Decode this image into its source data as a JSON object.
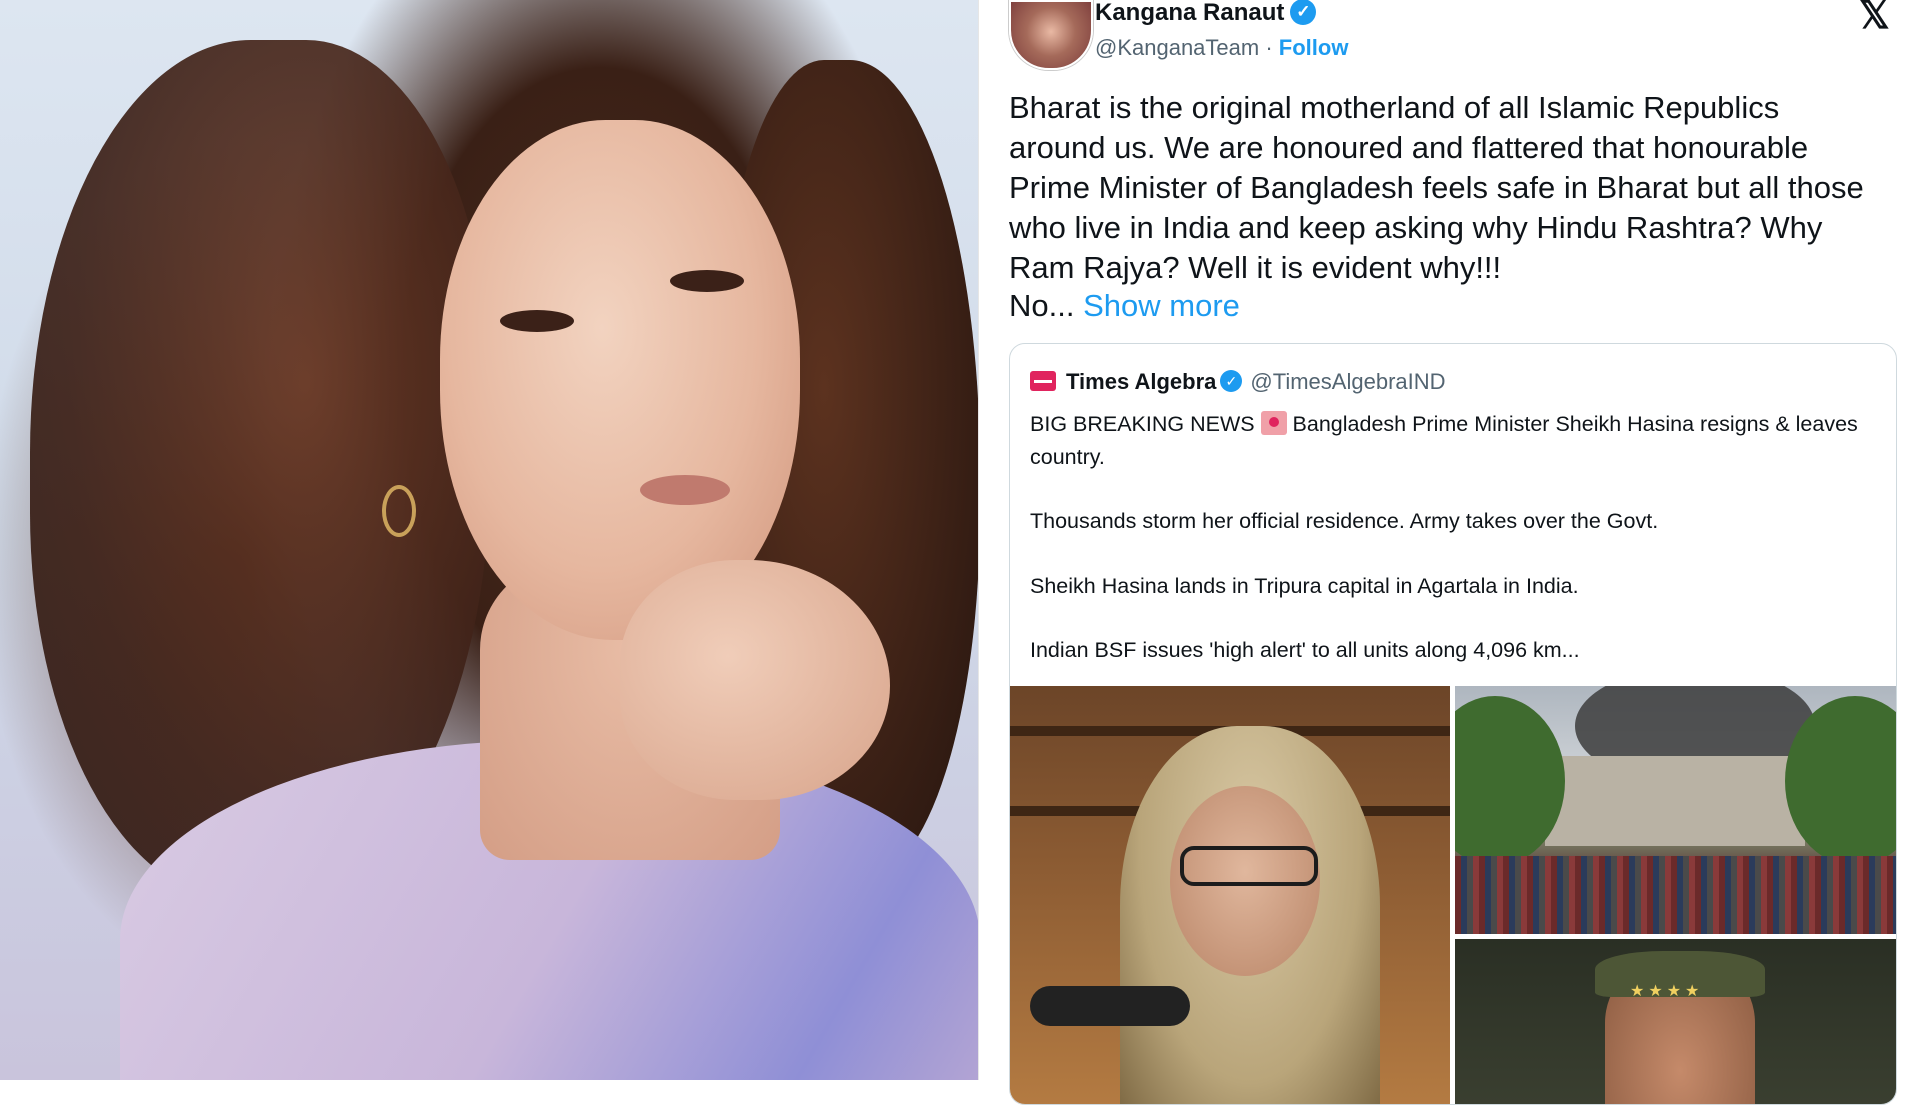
{
  "portrait": {
    "description_icon": "portrait-photo"
  },
  "tweet": {
    "author": {
      "name": "Kangana Ranaut",
      "verified_glyph": "✓",
      "handle": "@KanganaTeam",
      "separator": " · ",
      "follow_label": "Follow"
    },
    "close_glyph": "𝕏",
    "text": "Bharat is the original motherland of all Islamic Republics\naround us. We are honoured and flattered that honourable\nPrime Minister of Bangladesh feels safe in Bharat but all those\nwho live in India and keep asking why Hindu Rashtra? Why\nRam Rajya? Well it is evident why!!!",
    "truncated_prefix": "No... ",
    "show_more_label": "Show more",
    "quote": {
      "name": "Times Algebra",
      "verified_glyph": "✓",
      "handle": "@TimesAlgebraIND",
      "line1_prefix": "BIG BREAKING NEWS ",
      "line1_suffix": " Bangladesh Prime Minister Sheikh Hasina resigns & leaves country.",
      "paragraph2": "Thousands storm her official residence. Army takes over the Govt.",
      "paragraph3": "Sheikh Hasina lands in Tripura capital in Agartala in India.",
      "paragraph4": "Indian BSF issues 'high alert' to all units along 4,096 km..."
    },
    "colors": {
      "accent": "#1d9bf0",
      "text": "#0f1419",
      "secondary": "#536471"
    }
  }
}
